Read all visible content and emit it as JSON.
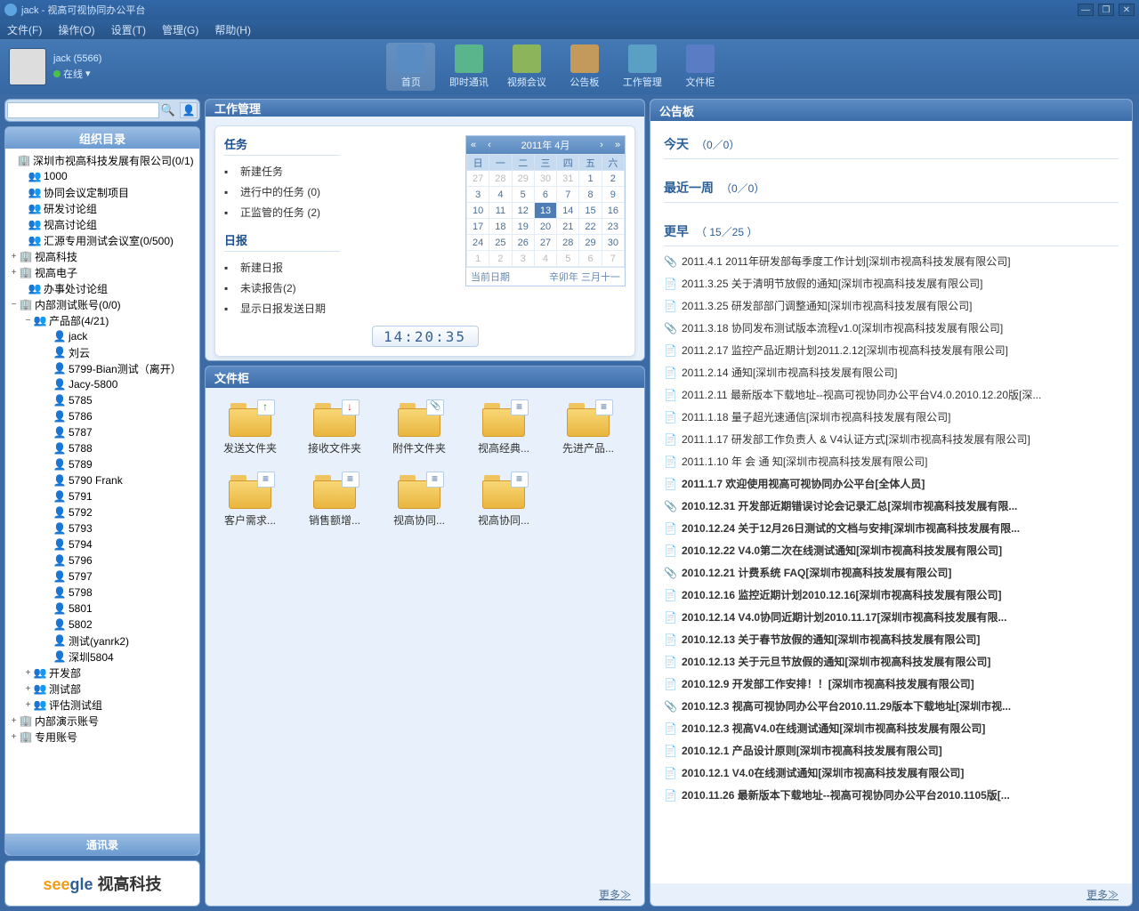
{
  "title": "jack - 视高可视协同办公平台",
  "menu": [
    "文件(F)",
    "操作(O)",
    "设置(T)",
    "管理(G)",
    "帮助(H)"
  ],
  "user": {
    "name": "jack (5566)",
    "status": "在线"
  },
  "topnav": [
    {
      "label": "首页",
      "color": "#5a8cc4"
    },
    {
      "label": "即时通讯",
      "color": "#5ab48c"
    },
    {
      "label": "视频会议",
      "color": "#8cb45a"
    },
    {
      "label": "公告板",
      "color": "#c49a5a"
    },
    {
      "label": "工作管理",
      "color": "#5aa0c4"
    },
    {
      "label": "文件柜",
      "color": "#5a7cc4"
    }
  ],
  "sidebar": {
    "org_tab": "组织目录",
    "contacts_tab": "通讯录",
    "tree": [
      {
        "pad": 0,
        "exp": "",
        "icon": "org",
        "label": "深圳市视高科技发展有限公司(0/1)"
      },
      {
        "pad": 12,
        "exp": "",
        "icon": "grp",
        "label": "1000"
      },
      {
        "pad": 12,
        "exp": "",
        "icon": "grp",
        "label": "协同会议定制项目"
      },
      {
        "pad": 12,
        "exp": "",
        "icon": "grp",
        "label": "研发讨论组"
      },
      {
        "pad": 12,
        "exp": "",
        "icon": "grp",
        "label": "视高讨论组"
      },
      {
        "pad": 12,
        "exp": "",
        "icon": "grp",
        "label": "汇源专用测试会议室(0/500)"
      },
      {
        "pad": 2,
        "exp": "+",
        "icon": "org",
        "label": "视高科技"
      },
      {
        "pad": 2,
        "exp": "+",
        "icon": "org",
        "label": "视高电子"
      },
      {
        "pad": 12,
        "exp": "",
        "icon": "grp",
        "label": "办事处讨论组"
      },
      {
        "pad": 2,
        "exp": "−",
        "icon": "org",
        "label": "内部测试账号(0/0)"
      },
      {
        "pad": 18,
        "exp": "−",
        "icon": "grp",
        "label": "产品部(4/21)"
      },
      {
        "pad": 40,
        "exp": "",
        "icon": "usr on",
        "label": "jack"
      },
      {
        "pad": 40,
        "exp": "",
        "icon": "usr on",
        "label": "刘云"
      },
      {
        "pad": 40,
        "exp": "",
        "icon": "usr away",
        "label": "5799-Bian测试（离开）"
      },
      {
        "pad": 40,
        "exp": "",
        "icon": "usr",
        "label": "Jacy-5800"
      },
      {
        "pad": 40,
        "exp": "",
        "icon": "usr",
        "label": "5785"
      },
      {
        "pad": 40,
        "exp": "",
        "icon": "usr",
        "label": "5786"
      },
      {
        "pad": 40,
        "exp": "",
        "icon": "usr",
        "label": "5787"
      },
      {
        "pad": 40,
        "exp": "",
        "icon": "usr",
        "label": "5788"
      },
      {
        "pad": 40,
        "exp": "",
        "icon": "usr",
        "label": "5789"
      },
      {
        "pad": 40,
        "exp": "",
        "icon": "usr",
        "label": "5790 Frank"
      },
      {
        "pad": 40,
        "exp": "",
        "icon": "usr",
        "label": "5791"
      },
      {
        "pad": 40,
        "exp": "",
        "icon": "usr",
        "label": "5792"
      },
      {
        "pad": 40,
        "exp": "",
        "icon": "usr",
        "label": "5793"
      },
      {
        "pad": 40,
        "exp": "",
        "icon": "usr",
        "label": "5794"
      },
      {
        "pad": 40,
        "exp": "",
        "icon": "usr",
        "label": "5796"
      },
      {
        "pad": 40,
        "exp": "",
        "icon": "usr",
        "label": "5797"
      },
      {
        "pad": 40,
        "exp": "",
        "icon": "usr",
        "label": "5798"
      },
      {
        "pad": 40,
        "exp": "",
        "icon": "usr",
        "label": "5801"
      },
      {
        "pad": 40,
        "exp": "",
        "icon": "usr",
        "label": "5802"
      },
      {
        "pad": 40,
        "exp": "",
        "icon": "usr",
        "label": "测试(yanrk2)"
      },
      {
        "pad": 40,
        "exp": "",
        "icon": "usr",
        "label": "深圳5804"
      },
      {
        "pad": 18,
        "exp": "+",
        "icon": "grp",
        "label": "开发部"
      },
      {
        "pad": 18,
        "exp": "+",
        "icon": "grp",
        "label": "测试部"
      },
      {
        "pad": 18,
        "exp": "+",
        "icon": "grp",
        "label": "评估测试组"
      },
      {
        "pad": 2,
        "exp": "+",
        "icon": "org",
        "label": "内部演示账号"
      },
      {
        "pad": 2,
        "exp": "+",
        "icon": "org",
        "label": "专用账号"
      }
    ]
  },
  "work": {
    "title": "工作管理",
    "task_title": "任务",
    "tasks": [
      {
        "label": "新建任务"
      },
      {
        "label": "进行中的任务 (0)"
      },
      {
        "label": "正监管的任务 (2)"
      }
    ],
    "daily_title": "日报",
    "daily": [
      {
        "label": "新建日报"
      },
      {
        "label": "未读报告(2)"
      },
      {
        "label": "显示日报发送日期"
      }
    ],
    "cal_month": "2011年 4月",
    "cal_today_label": "当前日期",
    "cal_lunar": "辛卯年 三月十一",
    "clock": "14:20:35",
    "cal_weekdays": [
      "日",
      "一",
      "二",
      "三",
      "四",
      "五",
      "六"
    ],
    "cal_days": [
      [
        "27",
        "28",
        "29",
        "30",
        "31",
        "1",
        "2"
      ],
      [
        "3",
        "4",
        "5",
        "6",
        "7",
        "8",
        "9"
      ],
      [
        "10",
        "11",
        "12",
        "13",
        "14",
        "15",
        "16"
      ],
      [
        "17",
        "18",
        "19",
        "20",
        "21",
        "22",
        "23"
      ],
      [
        "24",
        "25",
        "26",
        "27",
        "28",
        "29",
        "30"
      ],
      [
        "1",
        "2",
        "3",
        "4",
        "5",
        "6",
        "7"
      ]
    ],
    "today_cell": "13"
  },
  "cabinet": {
    "title": "文件柜",
    "more": "更多",
    "folders": [
      {
        "label": "发送文件夹",
        "badge": "up"
      },
      {
        "label": "接收文件夹",
        "badge": "down"
      },
      {
        "label": "附件文件夹",
        "badge": "clip"
      },
      {
        "label": "视高经典...",
        "badge": "doc"
      },
      {
        "label": "先进产品...",
        "badge": "doc"
      },
      {
        "label": "客户需求...",
        "badge": "doc"
      },
      {
        "label": "销售额增...",
        "badge": "doc"
      },
      {
        "label": "视高协同...",
        "badge": "doc"
      },
      {
        "label": "视高协同...",
        "badge": "doc"
      }
    ]
  },
  "bulletin": {
    "title": "公告板",
    "more": "更多",
    "today": {
      "label": "今天",
      "count": "（0／0）"
    },
    "week": {
      "label": "最近一周",
      "count": "（0／0）"
    },
    "older": {
      "label": "更早",
      "count": "（ 15／25 ）"
    },
    "items": [
      {
        "icon": "clip",
        "bold": false,
        "text": "2011.4.1 2011年研发部每季度工作计划[深圳市视高科技发展有限公司]"
      },
      {
        "icon": "doc",
        "bold": false,
        "text": "2011.3.25 关于清明节放假的通知[深圳市视高科技发展有限公司]"
      },
      {
        "icon": "doc",
        "bold": false,
        "text": "2011.3.25 研发部部门调整通知[深圳市视高科技发展有限公司]"
      },
      {
        "icon": "clip",
        "bold": false,
        "text": "2011.3.18 协同发布测试版本流程v1.0[深圳市视高科技发展有限公司]"
      },
      {
        "icon": "doc",
        "bold": false,
        "text": "2011.2.17 监控产品近期计划2011.2.12[深圳市视高科技发展有限公司]"
      },
      {
        "icon": "doc",
        "bold": false,
        "text": "2011.2.14 通知[深圳市视高科技发展有限公司]"
      },
      {
        "icon": "doc",
        "bold": false,
        "text": "2011.2.11 最新版本下载地址--视高可视协同办公平台V4.0.2010.12.20版[深..."
      },
      {
        "icon": "doc",
        "bold": false,
        "text": "2011.1.18 量子超光速通信[深圳市视高科技发展有限公司]"
      },
      {
        "icon": "doc",
        "bold": false,
        "text": "2011.1.17 研发部工作负责人 & V4认证方式[深圳市视高科技发展有限公司]"
      },
      {
        "icon": "doc",
        "bold": false,
        "text": "2011.1.10 年 会 通 知[深圳市视高科技发展有限公司]"
      },
      {
        "icon": "doc",
        "bold": true,
        "text": "2011.1.7 欢迎使用视高可视协同办公平台[全体人员]"
      },
      {
        "icon": "clip",
        "bold": true,
        "text": "2010.12.31 开发部近期错误讨论会记录汇总[深圳市视高科技发展有限..."
      },
      {
        "icon": "doc",
        "bold": true,
        "text": "2010.12.24 关于12月26日测试的文档与安排[深圳市视高科技发展有限..."
      },
      {
        "icon": "doc",
        "bold": true,
        "text": "2010.12.22 V4.0第二次在线测试通知[深圳市视高科技发展有限公司]"
      },
      {
        "icon": "clip",
        "bold": true,
        "text": "2010.12.21 计费系统 FAQ[深圳市视高科技发展有限公司]"
      },
      {
        "icon": "doc",
        "bold": true,
        "text": "2010.12.16 监控近期计划2010.12.16[深圳市视高科技发展有限公司]"
      },
      {
        "icon": "doc",
        "bold": true,
        "text": "2010.12.14 V4.0协同近期计划2010.11.17[深圳市视高科技发展有限..."
      },
      {
        "icon": "doc",
        "bold": true,
        "text": "2010.12.13 关于春节放假的通知[深圳市视高科技发展有限公司]"
      },
      {
        "icon": "doc",
        "bold": true,
        "text": "2010.12.13 关于元旦节放假的通知[深圳市视高科技发展有限公司]"
      },
      {
        "icon": "doc",
        "bold": true,
        "text": "2010.12.9 开发部工作安排！！[深圳市视高科技发展有限公司]"
      },
      {
        "icon": "clip",
        "bold": true,
        "text": "2010.12.3 视高可视协同办公平台2010.11.29版本下载地址[深圳市视..."
      },
      {
        "icon": "doc",
        "bold": true,
        "text": "2010.12.3 视高V4.0在线测试通知[深圳市视高科技发展有限公司]"
      },
      {
        "icon": "doc",
        "bold": true,
        "text": "2010.12.1 产品设计原则[深圳市视高科技发展有限公司]"
      },
      {
        "icon": "doc",
        "bold": true,
        "text": "2010.12.1 V4.0在线测试通知[深圳市视高科技发展有限公司]"
      },
      {
        "icon": "doc",
        "bold": true,
        "text": "2010.11.26 最新版本下载地址--视高可视协同办公平台2010.1105版[..."
      }
    ]
  },
  "logo": {
    "en1": "see",
    "en2": "gle",
    "cn": "视高科技"
  }
}
